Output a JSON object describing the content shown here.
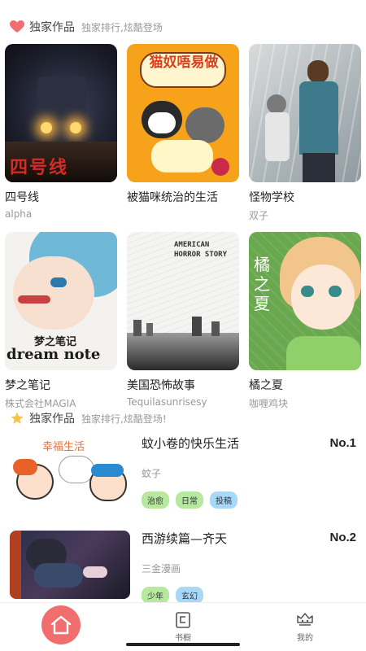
{
  "section1": {
    "title": "独家作品",
    "subtitle": "独家排行,炫酷登场",
    "icon": "heart-icon",
    "icon_color": "#f26e6e"
  },
  "grid": [
    {
      "name": "四号线",
      "author": "alpha",
      "cover_text": "四号线"
    },
    {
      "name": "被猫咪统治的生活",
      "author": "",
      "cover_text": "猫奴唔易做"
    },
    {
      "name": "怪物学校",
      "author": "双子",
      "cover_text": ""
    },
    {
      "name": "梦之笔记",
      "author": "株式会社MAGIA",
      "cover_text": "梦之笔记",
      "cover_text2": "dream note"
    },
    {
      "name": "美国恐怖故事",
      "author": "Tequilasunrisesy",
      "cover_text": "AMERICAN HORROR STORY"
    },
    {
      "name": "橘之夏",
      "author": "咖喱鸡块",
      "cover_text": "橘之夏"
    }
  ],
  "section2": {
    "title": "独家作品",
    "subtitle": "独家排行,炫酷登场!",
    "icon": "star-icon",
    "icon_color": "#f5c24a"
  },
  "ranking": [
    {
      "title": "蚊小卷的快乐生活",
      "author": "蚊子",
      "rank": "No.1",
      "thumb_text": "幸福生活",
      "tags": [
        {
          "label": "治愈",
          "color": "green"
        },
        {
          "label": "日常",
          "color": "green"
        },
        {
          "label": "投稿",
          "color": "blue"
        }
      ]
    },
    {
      "title": "西游续篇—齐天",
      "author": "三金漫画",
      "rank": "No.2",
      "thumb_text": "",
      "tags": [
        {
          "label": "少年",
          "color": "green"
        },
        {
          "label": "玄幻",
          "color": "blue"
        }
      ]
    }
  ],
  "tabbar": [
    {
      "label": "",
      "icon": "home-icon",
      "active": true
    },
    {
      "label": "书橱",
      "icon": "bookshelf-icon"
    },
    {
      "label": "我的",
      "icon": "profile-icon"
    }
  ],
  "colors": {
    "accent": "#f26e6e",
    "tag_green": "#b6e8a0",
    "tag_blue": "#a8d8f8"
  }
}
